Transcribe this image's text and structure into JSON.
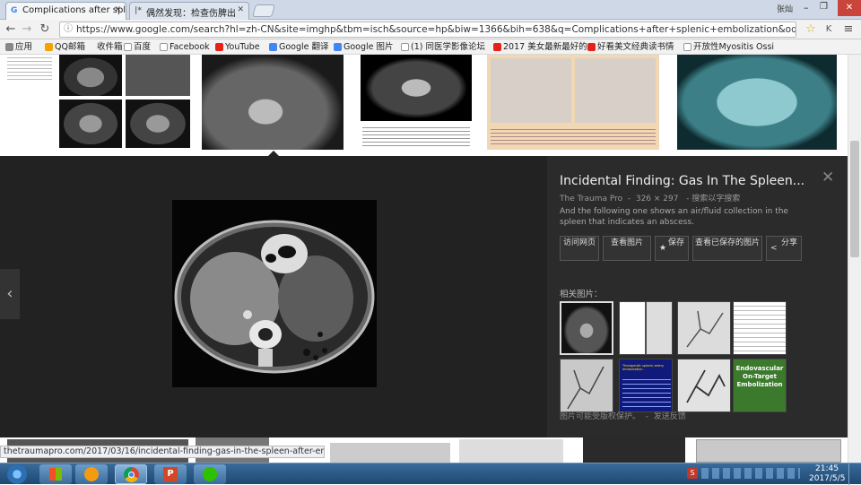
{
  "browser": {
    "tabs": [
      {
        "title": "Complications after spl",
        "active": true,
        "icon": "google-icon"
      },
      {
        "title": "偶然发现：检查伤脾出",
        "active": false,
        "icon": "page-icon"
      }
    ],
    "window_user": "张灿",
    "address": "https://www.google.com/search?hl=zh-CN&site=imghp&tbm=isch&source=hp&biw=1366&bih=638&q=Complications+after+splenic+embolization&oq=Complicat",
    "bookmarks": [
      {
        "label": "应用",
        "color": "#888888"
      },
      {
        "label": "QQ邮箱",
        "color": "#f4a300"
      },
      {
        "label": "收件箱",
        "color": "#dddddd"
      },
      {
        "label": "百度",
        "color": "#2f5fd0"
      },
      {
        "label": "Facebook",
        "color": "#888888"
      },
      {
        "label": "YouTube",
        "color": "#e62117"
      },
      {
        "label": "Google 翻译",
        "color": "#4285f4"
      },
      {
        "label": "Google 图片",
        "color": "#4285f4"
      },
      {
        "label": "(1) 同医学影像论坛",
        "color": "#888888"
      },
      {
        "label": "2017 美女最新最好的",
        "color": "#e62117"
      },
      {
        "label": "好看美文经典读书情",
        "color": "#e62117"
      },
      {
        "label": "开放性Myositis Ossi",
        "color": "#888888"
      }
    ]
  },
  "preview": {
    "title": "Incidental Finding: Gas In The Spleen...",
    "source": "The Trauma Pro",
    "dimensions": "326 × 297",
    "source_suffix": "- 搜索以字搜索",
    "description": "And the following one shows an air/fluid collection in the spleen that indicates an abscess.",
    "buttons": [
      {
        "label": "访问网页",
        "icon": ""
      },
      {
        "label": "查看图片",
        "icon": ""
      },
      {
        "label": "保存",
        "icon": "star-icon"
      },
      {
        "label": "查看已保存的图片",
        "icon": ""
      },
      {
        "label": "分享",
        "icon": "share-icon"
      }
    ],
    "related_label": "相关图片：",
    "related_images": [
      {
        "label": "CT abdomen"
      },
      {
        "label": "CT collage"
      },
      {
        "label": "angiography"
      },
      {
        "label": "document"
      },
      {
        "label": "angiography"
      },
      {
        "label": "Therapeutic splenic artery embolization"
      },
      {
        "label": "angiography"
      },
      {
        "label": "Endovascular On-Target Embolization"
      }
    ],
    "related_footer": "图片可能受版权保护。",
    "feedback": "发送反馈"
  },
  "status_url": "thetraumapro.com/2017/03/16/incidental-finding-gas-in-the-spleen-after-embolization/",
  "taskbar": {
    "time": "21:45",
    "date": "2017/5/5"
  },
  "colors": {
    "accent": "#4285f4",
    "panel_bg": "#222222",
    "taskbar": "#1d4872"
  }
}
